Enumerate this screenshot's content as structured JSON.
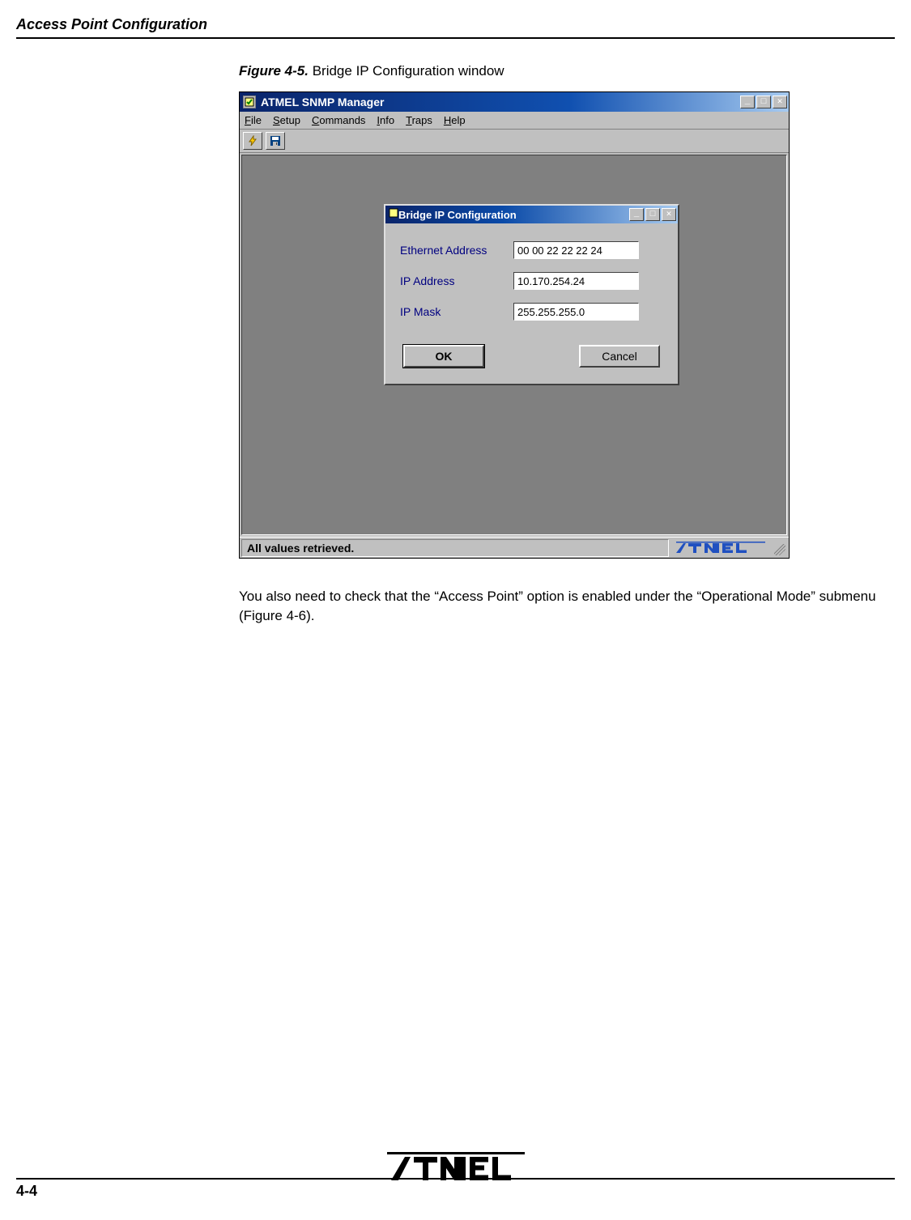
{
  "page": {
    "header": "Access Point Configuration",
    "figure_label": "Figure 4-5.",
    "figure_title": "Bridge IP Configuration window",
    "body_text": "You also need to check that the “Access Point” option is enabled under the “Operational Mode” submenu (Figure 4-6).",
    "page_number": "4-4",
    "footer_brand": "ATMEL"
  },
  "outer_window": {
    "title": "ATMEL SNMP Manager",
    "menu": {
      "file": "File",
      "setup": "Setup",
      "commands": "Commands",
      "info": "Info",
      "traps": "Traps",
      "help": "Help"
    },
    "status": "All values retrieved.",
    "brand": "ATMEL"
  },
  "inner_dialog": {
    "title": "Bridge IP Configuration",
    "fields": {
      "ethernet_label": "Ethernet Address",
      "ethernet_value": "00 00 22 22 22 24",
      "ip_label": "IP Address",
      "ip_value": "10.170.254.24",
      "mask_label": "IP Mask",
      "mask_value": "255.255.255.0"
    },
    "ok": "OK",
    "cancel": "Cancel"
  },
  "icons": {
    "minimize": "_",
    "maximize": "□",
    "close": "✕",
    "lightning": "⚡",
    "save": "💾"
  }
}
